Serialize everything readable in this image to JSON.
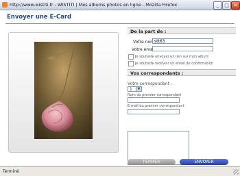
{
  "window": {
    "title": "http://www.wistiti.fr - WISTITI | Mes albums photos en ligne - Mozilla Firefox",
    "controls": {
      "minimize": "_",
      "maximize": "□",
      "close": "✕"
    }
  },
  "dialog": {
    "title": "Envoyer une E-Card"
  },
  "sender": {
    "heading": "De la part de :",
    "name_label": "Votre nom",
    "name_value": "stt63",
    "email_label": "Votre email",
    "email_value": "",
    "option_link_label": "Je souhaite envoyer un lien sur mon album",
    "option_confirm_label": "Je souhaite recevoir un email de confirmation"
  },
  "recipients": {
    "heading": "Vos correspondants :",
    "count_label": "Votre correspondant :",
    "count_value": "1",
    "first_name_label": "Nom du premier correspondant",
    "first_email_label": "E-mail du premier correspondant"
  },
  "actions": {
    "close_label": "FERMER",
    "send_label": "ENVOYER"
  },
  "status": {
    "text": "Terminé"
  },
  "colors": {
    "accent": "#214a8e",
    "send_button": "#2e4db3",
    "close_button": "#a9a9a9"
  }
}
